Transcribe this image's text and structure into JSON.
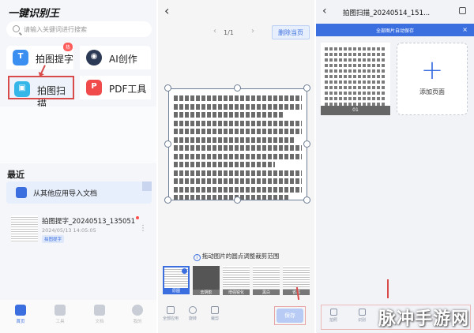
{
  "panel1": {
    "app_title": "一键识别王",
    "search_placeholder": "请输入关键词进行搜索",
    "features": [
      {
        "label": "拍图提字",
        "badge": "热"
      },
      {
        "label": "AI创作"
      },
      {
        "label": "拍图扫描"
      },
      {
        "label": "PDF工具"
      }
    ],
    "recent_title": "最近",
    "import_label": "从其他应用导入文档",
    "file": {
      "name": "拍图提字_20240513_135051",
      "date": "2024/05/13 14:05:05",
      "tag": "拍图提字"
    },
    "nav": [
      "首页",
      "工具",
      "文档",
      "我的"
    ]
  },
  "panel2": {
    "page_indicator": "1/1",
    "delete_label": "删除当页",
    "tip": "拖动图片的圆点调整裁剪范围",
    "filters": [
      "原图",
      "去阴影",
      "增强锐化",
      "黑白",
      "省墨"
    ],
    "tools": [
      "全部应用",
      "旋转",
      "裁剪"
    ],
    "save_label": "保存"
  },
  "panel3": {
    "title": "拍图扫描_20240514_151...",
    "banner": "全部图片自动保存",
    "page_number": "01",
    "add_page_label": "添加页面",
    "tools": [
      "拍照",
      "识别"
    ]
  },
  "watermark": "脉冲手游网",
  "colors": {
    "accent": "#3b6fe0",
    "highlight": "#d94b4b"
  }
}
